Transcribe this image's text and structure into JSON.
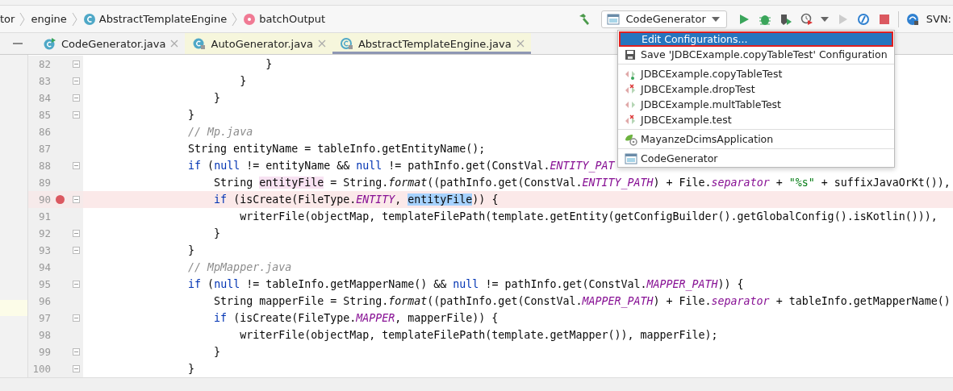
{
  "breadcrumb": [
    {
      "label": "tor",
      "kind": "folder"
    },
    {
      "label": "engine",
      "kind": "folder"
    },
    {
      "label": "AbstractTemplateEngine",
      "kind": "class"
    },
    {
      "label": "batchOutput",
      "kind": "method"
    }
  ],
  "toolbar": {
    "run_config": "CodeGenerator",
    "svn_label": "SVN:"
  },
  "tabs": [
    {
      "label": "CodeGenerator.java",
      "selected": false,
      "kind": "runnable"
    },
    {
      "label": "AutoGenerator.java",
      "selected": false,
      "kind": "locked"
    },
    {
      "label": "AbstractTemplateEngine.java",
      "selected": true,
      "kind": "abstract"
    }
  ],
  "code_lines": [
    {
      "number": "82",
      "breakpoint": false,
      "fold": true,
      "tokens": [
        {
          "t": "                            }",
          "kind": "plain"
        }
      ]
    },
    {
      "number": "83",
      "breakpoint": false,
      "fold": true,
      "tokens": [
        {
          "t": "                        }",
          "kind": "plain"
        }
      ]
    },
    {
      "number": "84",
      "breakpoint": false,
      "fold": true,
      "tokens": [
        {
          "t": "                    }",
          "kind": "plain"
        }
      ]
    },
    {
      "number": "85",
      "breakpoint": false,
      "fold": true,
      "tokens": [
        {
          "t": "                }",
          "kind": "plain"
        }
      ]
    },
    {
      "number": "86",
      "breakpoint": false,
      "fold": false,
      "tokens": [
        {
          "t": "                // Mp.java",
          "kind": "comment"
        }
      ]
    },
    {
      "number": "87",
      "breakpoint": false,
      "fold": false,
      "tokens": [
        {
          "t": "                String entityName = tableInfo.getEntityName();",
          "kind": "plain"
        }
      ]
    },
    {
      "number": "88",
      "breakpoint": false,
      "fold": true,
      "tokens": [
        {
          "t": "                if",
          "kind": "keyword"
        },
        {
          "t": " (",
          "kind": "plain"
        },
        {
          "t": "null",
          "kind": "keyword"
        },
        {
          "t": " != entityName && ",
          "kind": "plain"
        },
        {
          "t": "null",
          "kind": "keyword"
        },
        {
          "t": " != pathInfo.get(ConstVal.",
          "kind": "plain"
        },
        {
          "t": "ENTITY_PAT",
          "kind": "constant"
        }
      ]
    },
    {
      "number": "89",
      "breakpoint": false,
      "fold": false,
      "tokens": [
        {
          "t": "                    String ",
          "kind": "plain"
        },
        {
          "t": "entityFile",
          "kind": "usage"
        },
        {
          "t": " = String.",
          "kind": "plain"
        },
        {
          "t": "format",
          "kind": "static-call"
        },
        {
          "t": "((pathInfo.get(ConstVal.",
          "kind": "plain"
        },
        {
          "t": "ENTITY_PATH",
          "kind": "constant"
        },
        {
          "t": ") + File.",
          "kind": "plain"
        },
        {
          "t": "separator",
          "kind": "constant"
        },
        {
          "t": " + ",
          "kind": "plain"
        },
        {
          "t": "\"%s\"",
          "kind": "string"
        },
        {
          "t": " + suffixJavaOrKt()),",
          "kind": "plain"
        }
      ]
    },
    {
      "number": "90",
      "breakpoint": true,
      "fold": true,
      "tokens": [
        {
          "t": "                    if",
          "kind": "keyword"
        },
        {
          "t": " (isCreate(FileType.",
          "kind": "plain"
        },
        {
          "t": "ENTITY",
          "kind": "constant"
        },
        {
          "t": ", ",
          "kind": "plain"
        },
        {
          "t": "entityFile",
          "kind": "selection"
        },
        {
          "t": ")) {",
          "kind": "plain"
        }
      ]
    },
    {
      "number": "91",
      "breakpoint": false,
      "fold": false,
      "tokens": [
        {
          "t": "                        writerFile(objectMap, templateFilePath(template.getEntity(getConfigBuilder().getGlobalConfig().isKotlin())),",
          "kind": "plain"
        }
      ]
    },
    {
      "number": "92",
      "breakpoint": false,
      "fold": true,
      "tokens": [
        {
          "t": "                    }",
          "kind": "plain"
        }
      ]
    },
    {
      "number": "93",
      "breakpoint": false,
      "fold": true,
      "tokens": [
        {
          "t": "                }",
          "kind": "plain"
        }
      ]
    },
    {
      "number": "94",
      "breakpoint": false,
      "fold": false,
      "tokens": [
        {
          "t": "                // MpMapper.java",
          "kind": "comment"
        }
      ]
    },
    {
      "number": "95",
      "breakpoint": false,
      "fold": true,
      "tokens": [
        {
          "t": "                if",
          "kind": "keyword"
        },
        {
          "t": " (",
          "kind": "plain"
        },
        {
          "t": "null",
          "kind": "keyword"
        },
        {
          "t": " != tableInfo.getMapperName() && ",
          "kind": "plain"
        },
        {
          "t": "null",
          "kind": "keyword"
        },
        {
          "t": " != pathInfo.get(ConstVal.",
          "kind": "plain"
        },
        {
          "t": "MAPPER_PATH",
          "kind": "constant"
        },
        {
          "t": ")) {",
          "kind": "plain"
        }
      ]
    },
    {
      "number": "96",
      "breakpoint": false,
      "fold": false,
      "tokens": [
        {
          "t": "                    String mapperFile = String.",
          "kind": "plain"
        },
        {
          "t": "format",
          "kind": "static-call"
        },
        {
          "t": "((pathInfo.get(ConstVal.",
          "kind": "plain"
        },
        {
          "t": "MAPPER_PATH",
          "kind": "constant"
        },
        {
          "t": ") + File.",
          "kind": "plain"
        },
        {
          "t": "separator",
          "kind": "constant"
        },
        {
          "t": " + tableInfo.getMapperName()",
          "kind": "plain"
        }
      ]
    },
    {
      "number": "97",
      "breakpoint": false,
      "fold": true,
      "tokens": [
        {
          "t": "                    if",
          "kind": "keyword"
        },
        {
          "t": " (isCreate(FileType.",
          "kind": "plain"
        },
        {
          "t": "MAPPER",
          "kind": "constant"
        },
        {
          "t": ", mapperFile)) {",
          "kind": "plain"
        }
      ]
    },
    {
      "number": "98",
      "breakpoint": false,
      "fold": false,
      "tokens": [
        {
          "t": "                        writerFile(objectMap, templateFilePath(template.getMapper()), mapperFile);",
          "kind": "plain"
        }
      ]
    },
    {
      "number": "99",
      "breakpoint": false,
      "fold": true,
      "tokens": [
        {
          "t": "                    }",
          "kind": "plain"
        }
      ]
    },
    {
      "number": "100",
      "breakpoint": false,
      "fold": true,
      "tokens": [
        {
          "t": "                }",
          "kind": "plain"
        }
      ]
    }
  ],
  "popup_menu": {
    "groups": [
      [
        {
          "label": "Edit Configurations...",
          "kind": "action",
          "selected": true
        },
        {
          "label": "Save 'JDBCExample.copyTableTest' Configuration",
          "kind": "save",
          "selected": false
        }
      ],
      [
        {
          "label": "JDBCExample.copyTableTest",
          "kind": "test-ok",
          "selected": false
        },
        {
          "label": "JDBCExample.dropTest",
          "kind": "test-error",
          "selected": false
        },
        {
          "label": "JDBCExample.multTableTest",
          "kind": "test",
          "selected": false
        },
        {
          "label": "JDBCExample.test",
          "kind": "test-error",
          "selected": false
        }
      ],
      [
        {
          "label": "MayanzeDcimsApplication",
          "kind": "spring",
          "selected": false
        }
      ],
      [
        {
          "label": "CodeGenerator",
          "kind": "app",
          "selected": false
        }
      ]
    ]
  }
}
